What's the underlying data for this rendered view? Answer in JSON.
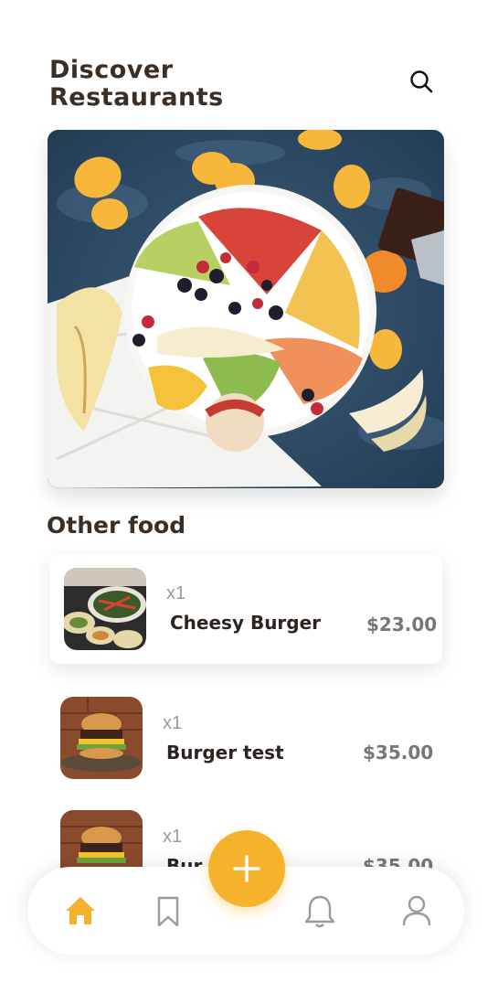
{
  "header": {
    "title_line1": "Discover",
    "title_line2": "Restaurants"
  },
  "section": {
    "title": "Other food"
  },
  "foods": [
    {
      "qty": "x1",
      "name": "Cheesy Burger",
      "price": "$23.00"
    },
    {
      "qty": "x1",
      "name": "Burger test",
      "price": "$35.00"
    },
    {
      "qty": "x1",
      "name": "Bur",
      "price": "$35.00"
    }
  ],
  "nav": {
    "active": "home",
    "items": [
      "home-icon",
      "bookmark-icon",
      "add-icon",
      "bell-icon",
      "user-icon"
    ]
  },
  "colors": {
    "accent": "#f5b32d",
    "title": "#3b2f25",
    "muted": "#9a9a9a"
  }
}
